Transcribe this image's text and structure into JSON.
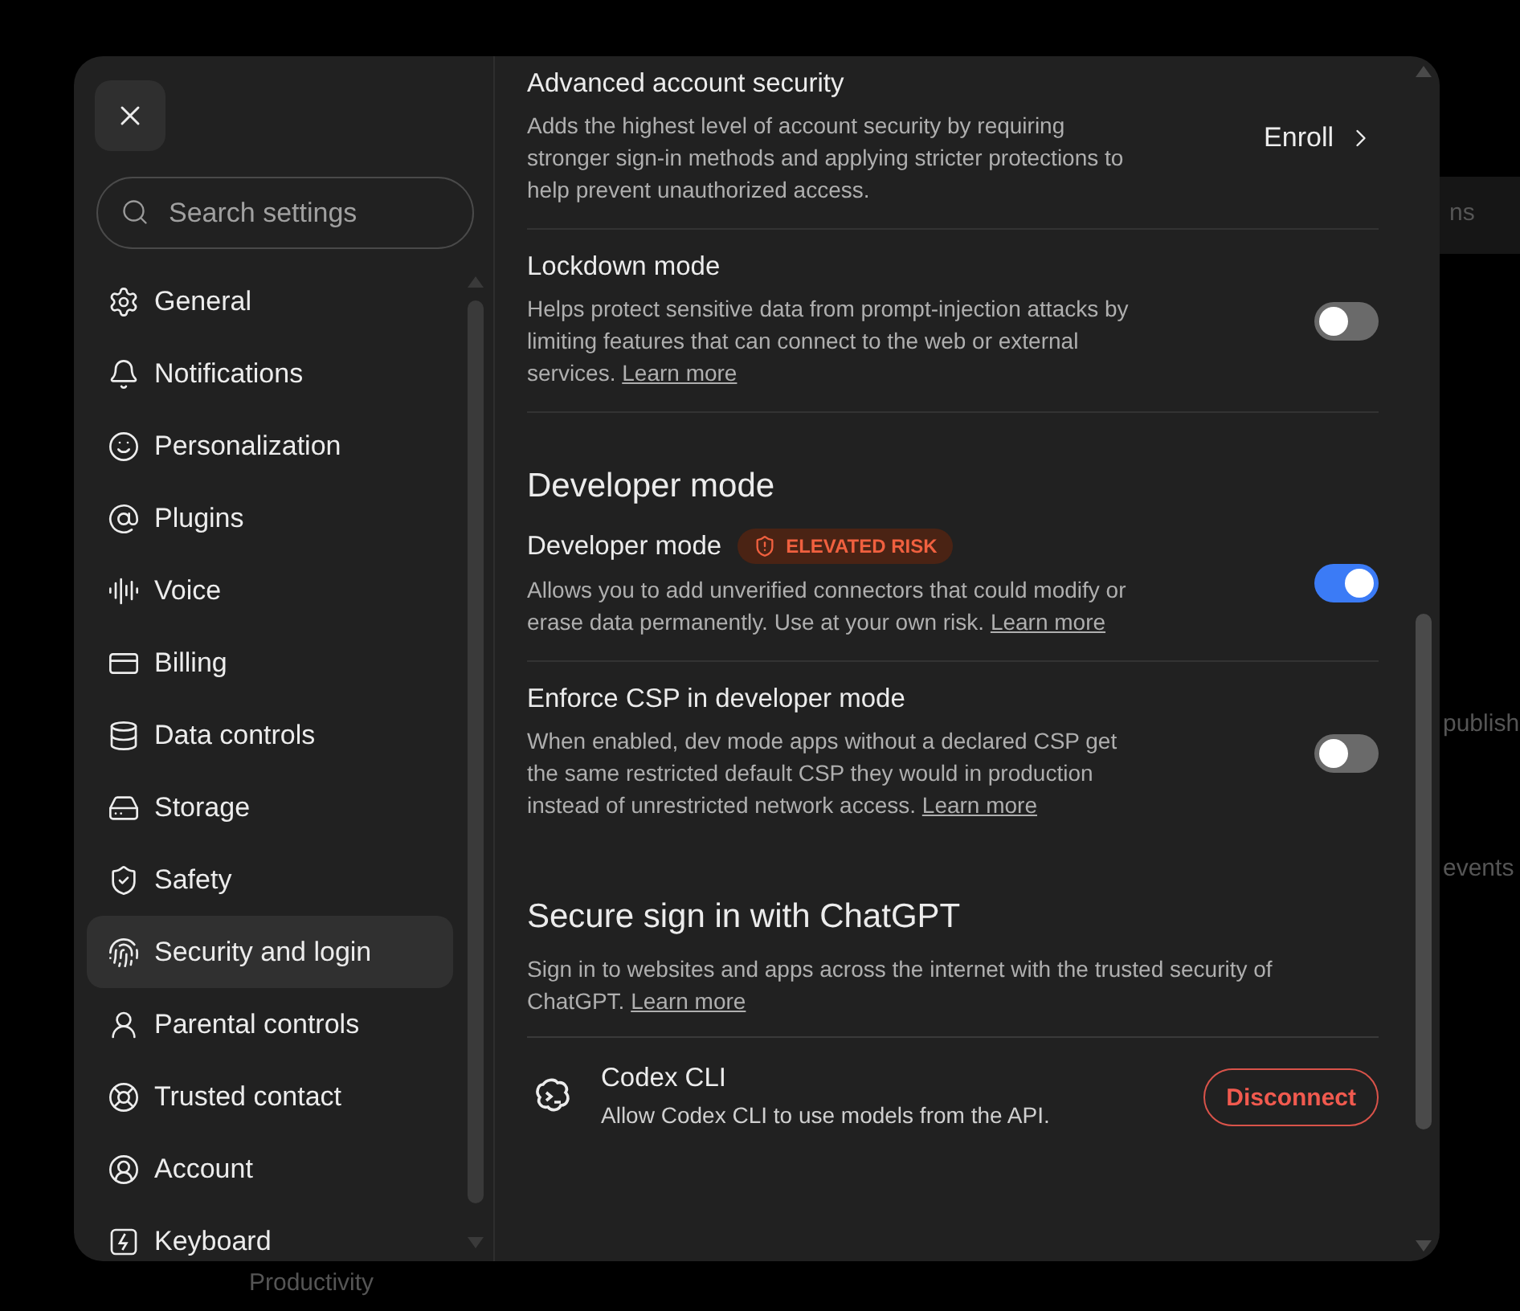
{
  "backdrop": [
    "ns",
    "publish",
    "events",
    "Productivity"
  ],
  "search": {
    "placeholder": "Search settings"
  },
  "sidebar": {
    "items": [
      {
        "label": "General",
        "selected": false
      },
      {
        "label": "Notifications",
        "selected": false
      },
      {
        "label": "Personalization",
        "selected": false
      },
      {
        "label": "Plugins",
        "selected": false
      },
      {
        "label": "Voice",
        "selected": false
      },
      {
        "label": "Billing",
        "selected": false
      },
      {
        "label": "Data controls",
        "selected": false
      },
      {
        "label": "Storage",
        "selected": false
      },
      {
        "label": "Safety",
        "selected": false
      },
      {
        "label": "Security and login",
        "selected": true
      },
      {
        "label": "Parental controls",
        "selected": false
      },
      {
        "label": "Trusted contact",
        "selected": false
      },
      {
        "label": "Account",
        "selected": false
      },
      {
        "label": "Keyboard",
        "selected": false
      }
    ]
  },
  "content": [
    {
      "kind": "setting",
      "title": "Advanced account security",
      "description": "Adds the highest level of account security by requiring stronger sign-in methods and applying stricter protections to help prevent unauthorized access.",
      "action": {
        "kind": "link",
        "label": "Enroll"
      }
    },
    {
      "kind": "setting",
      "title": "Lockdown mode",
      "description": "Helps protect sensitive data from prompt-injection attacks by limiting features that can connect to the web or external services.",
      "link": "Learn more",
      "action": {
        "kind": "toggle",
        "on": false
      }
    },
    {
      "kind": "heading",
      "title": "Developer mode"
    },
    {
      "kind": "setting",
      "title": "Developer mode",
      "badge": "ELEVATED RISK",
      "description": "Allows you to add unverified connectors that could modify or erase data permanently. Use at your own risk.",
      "link": "Learn more",
      "action": {
        "kind": "toggle",
        "on": true
      }
    },
    {
      "kind": "setting",
      "title": "Enforce CSP in developer mode",
      "description": "When enabled, dev mode apps without a declared CSP get the same restricted default CSP they would in production instead of unrestricted network access.",
      "link": "Learn more",
      "action": {
        "kind": "toggle",
        "on": false
      }
    },
    {
      "kind": "heading",
      "title": "Secure sign in with ChatGPT",
      "description": "Sign in to websites and apps across the internet with the trusted security of ChatGPT.",
      "link": "Learn more"
    },
    {
      "kind": "app",
      "title": "Codex CLI",
      "description": "Allow Codex CLI to use models from the API.",
      "action": {
        "kind": "button",
        "label": "Disconnect"
      }
    }
  ]
}
